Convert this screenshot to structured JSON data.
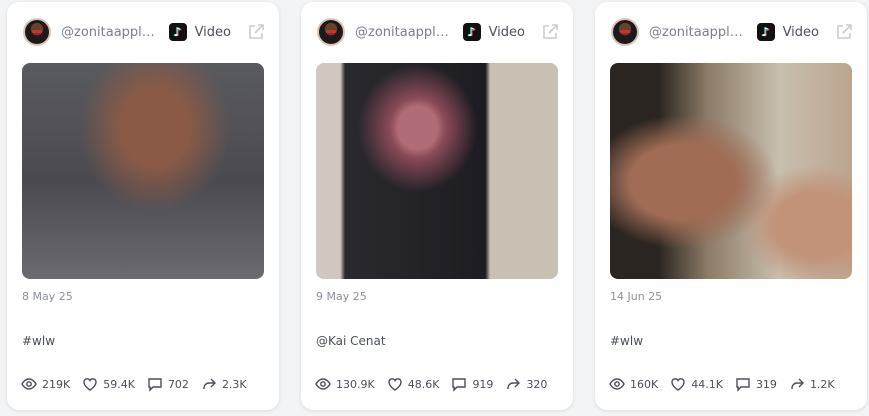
{
  "posts": [
    {
      "handle": "@zonitaapplez...",
      "platform_icon": "tiktok-icon",
      "type_label": "Video",
      "date": "8 May 25",
      "caption": "#wlw",
      "stats": {
        "views": "219K",
        "likes": "59.4K",
        "comments": "702",
        "shares": "2.3K"
      }
    },
    {
      "handle": "@zonitaapplez...",
      "platform_icon": "tiktok-icon",
      "type_label": "Video",
      "date": "9 May 25",
      "caption": "@Kai Cenat",
      "stats": {
        "views": "130.9K",
        "likes": "48.6K",
        "comments": "919",
        "shares": "320"
      }
    },
    {
      "handle": "@zonitaapplez...",
      "platform_icon": "tiktok-icon",
      "type_label": "Video",
      "date": "14 Jun 25",
      "caption": "#wlw",
      "stats": {
        "views": "160K",
        "likes": "44.1K",
        "comments": "319",
        "shares": "1.2K"
      }
    }
  ],
  "icons": {
    "views": "eye-icon",
    "likes": "heart-icon",
    "comments": "comment-icon",
    "shares": "share-icon",
    "external": "external-link-icon"
  },
  "colors": {
    "card_bg": "#ffffff",
    "page_bg": "#f3f4f6",
    "muted_text": "#8a8f99",
    "icon_gray": "#c9ccd2"
  }
}
